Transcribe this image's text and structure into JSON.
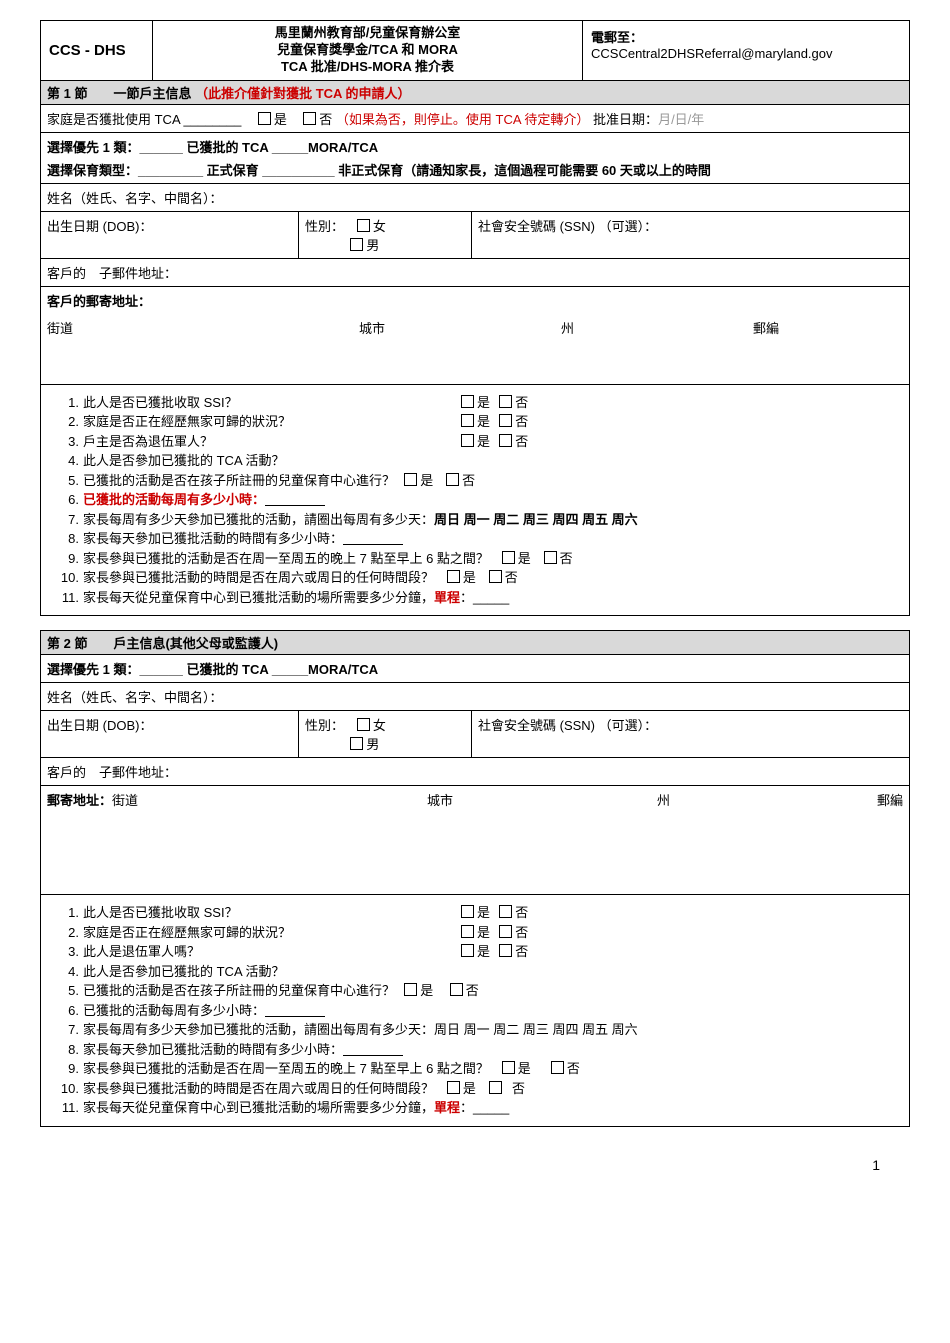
{
  "header": {
    "left": "CCS - DHS",
    "center1": "馬里蘭州教育部/兒童保育辦公室",
    "center2": "兒童保育獎學金/TCA 和 MORA",
    "center3": "TCA 批准/DHS-MORA 推介表",
    "emailLabel": "電郵至：",
    "emailValue": "CCSCentral2DHSReferral@maryland.gov"
  },
  "s1": {
    "title": "第 1 節　　一節戶主信息 ",
    "titleNote": "（此推介僅針對獲批 TCA 的申請人）",
    "tcaQ": "家庭是否獲批使用 TCA ________",
    "yes": "是",
    "no": "否 ",
    "noNote": "（如果為否，則停止。使用 TCA 待定轉介）",
    "approveDateLabel": "批准日期：",
    "approveDateHint": "月/日/年",
    "priority": "選擇優先 1 類：______   已獲批的 TCA _____MORA/TCA",
    "careType": "選擇保育類型：_________ 正式保育 __________ 非正式保育（請通知家長，這個過程可能需要 60 天或以上的時間",
    "nameLabel": "姓名（姓氏、名字、中間名）：",
    "dobLabel": "出生日期 (DOB)：",
    "genderLabel": "性別：",
    "female": "女",
    "male": "男",
    "ssnLabel": "社會安全號碼 (SSN) （可選）：",
    "emailLabel": "客戶的　子郵件地址：",
    "mailLabel": "客戶的郵寄地址：",
    "street": "街道",
    "city": "城市",
    "state": "州",
    "zip": "郵編"
  },
  "q": {
    "1": "此人是否已獲批收取 SSI？",
    "2": "家庭是否正在經歷無家可歸的狀況？",
    "3a": "戶主是否為退伍軍人？",
    "3b": "此人是退伍軍人嗎？",
    "4": "此人是否參加已獲批的 TCA 活動？",
    "5": "已獲批的活動是否在孩子所註冊的兒童保育中心進行？",
    "6a": "已獲批的活動每周有多少小時：",
    "6b": "已獲批的活動每周有多少小時：",
    "7": "家長每周有多少天參加已獲批的活動，請圈出每周有多少天：",
    "days": "周日  周一  周二  周三  周四  周五  周六",
    "8": "家長每天參加已獲批活動的時間有多少小時：",
    "9": "家長參與已獲批的活動是否在周一至周五的晚上 7 點至早上 6 點之間？",
    "10": "家長參與已獲批活動的時間是否在周六或周日的任何時間段？",
    "11a": "家長每天從兒童保育中心到已獲批活動的場所需要多少分鐘，",
    "11b": "單程",
    "11c": "：_____",
    "yes": "是",
    "no": "否"
  },
  "s2": {
    "title": "第 2 節　　戶主信息(其他父母或監護人)",
    "priority": "選擇優先 1 類：______   已獲批的 TCA _____MORA/TCA",
    "mailLabelPrefix": "郵寄地址：",
    "street": "街道",
    "city": "城市",
    "state": "州",
    "zip": "郵編"
  },
  "page": "1"
}
